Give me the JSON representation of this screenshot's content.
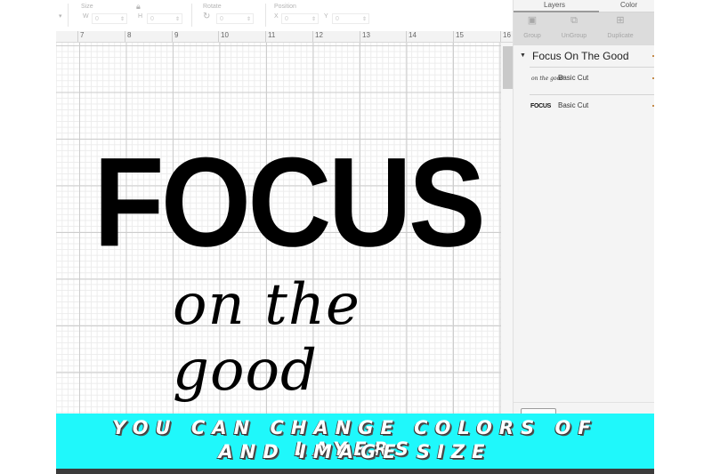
{
  "toolbar": {
    "size": {
      "label": "Size",
      "w_label": "W",
      "w_value": "0",
      "h_label": "H",
      "h_value": "0",
      "lock_icon": "lock-icon"
    },
    "rotate": {
      "label": "Rotate",
      "value": "0",
      "icon": "rotate-icon"
    },
    "position": {
      "label": "Position",
      "x_label": "X",
      "x_value": "0",
      "y_label": "Y",
      "y_value": "0"
    }
  },
  "ruler": {
    "marks": [
      "7",
      "8",
      "9",
      "10",
      "11",
      "12",
      "13",
      "14",
      "15",
      "16"
    ]
  },
  "canvas": {
    "artwork": {
      "headline": "FOCUS",
      "script": "on the good"
    }
  },
  "panel": {
    "tabs": [
      {
        "label": "Layers",
        "active": true
      },
      {
        "label": "Color Sync",
        "active": false
      }
    ],
    "actions": [
      {
        "label": "Group",
        "icon": "group-icon"
      },
      {
        "label": "UnGroup",
        "icon": "ungroup-icon"
      },
      {
        "label": "Duplicate",
        "icon": "duplicate-icon"
      }
    ],
    "group": {
      "title": "Focus On The Good",
      "expanded": true
    },
    "layers": [
      {
        "thumb": "on the good",
        "label": "Basic Cut"
      },
      {
        "thumb": "FOCUS",
        "label": "Basic Cut"
      }
    ]
  },
  "banner": {
    "line1": "YOU CAN CHANGE COLORS OF LAYERS",
    "line2": "AND IMAGE SIZE",
    "background": "#1ff8fb"
  }
}
